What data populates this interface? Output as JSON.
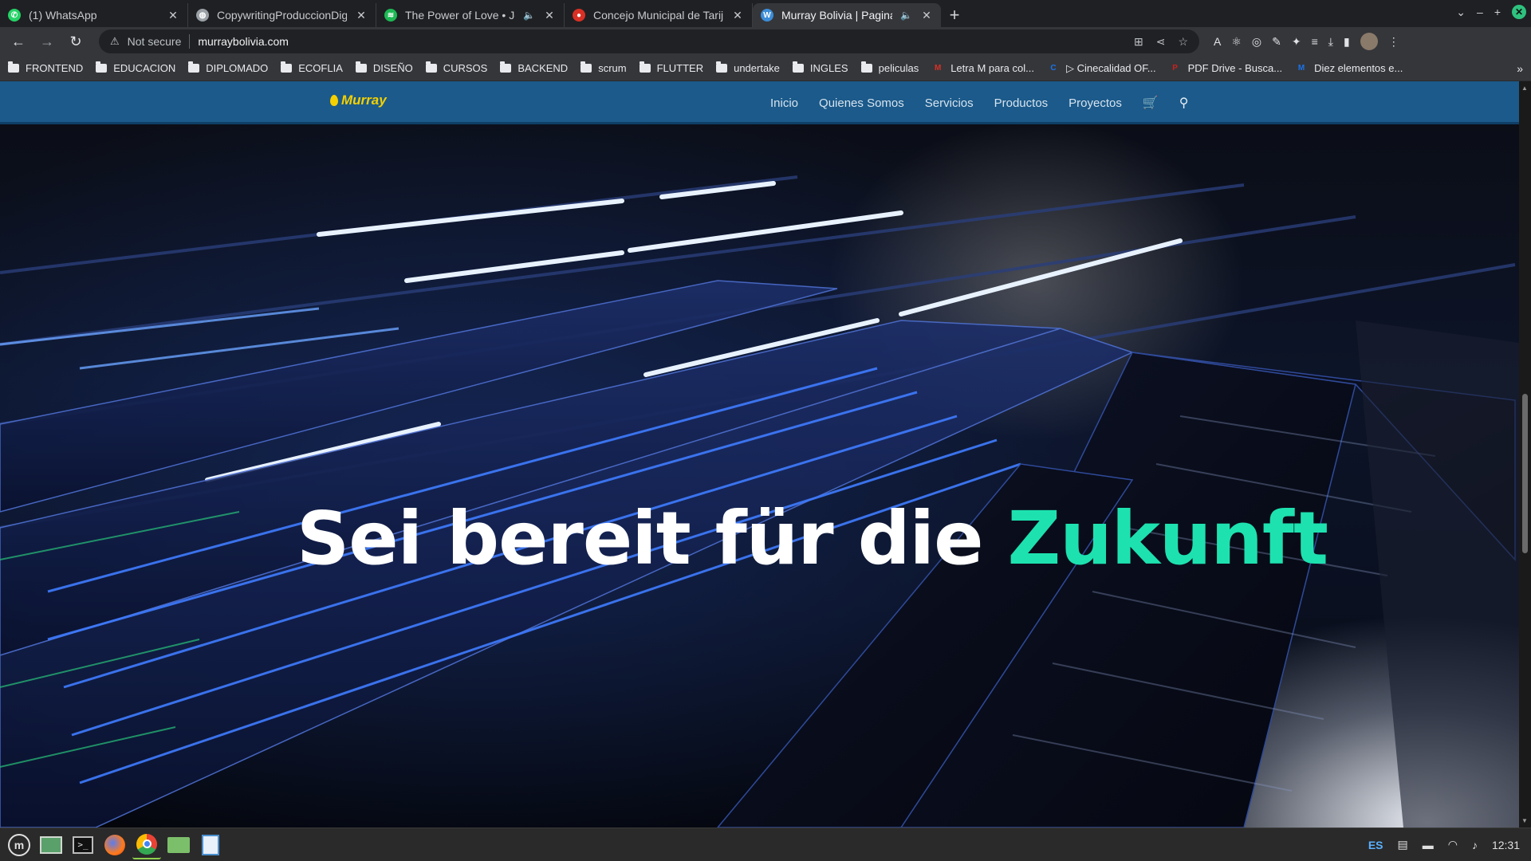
{
  "browser": {
    "tabs": [
      {
        "title": "(1) WhatsApp",
        "icon": "whatsapp-icon",
        "color": "#25d366",
        "audio": false,
        "active": false
      },
      {
        "title": "CopywritingProduccionDigital",
        "icon": "globe-icon",
        "color": "#9aa0a6",
        "audio": false,
        "active": false
      },
      {
        "title": "The Power of Love • Jennifer",
        "icon": "spotify-icon",
        "color": "#1db954",
        "audio": true,
        "active": false
      },
      {
        "title": "Concejo Municipal de Tarija",
        "icon": "municipal-icon",
        "color": "#d93025",
        "audio": false,
        "active": false
      },
      {
        "title": "Murray Bolivia | Pagina Of",
        "icon": "wordpress-icon",
        "color": "#3c8dd8",
        "audio": true,
        "active": true
      }
    ],
    "address": {
      "security": "Not secure",
      "url": "murraybolivia.com"
    },
    "bookmarks": [
      {
        "label": "FRONTEND",
        "type": "folder"
      },
      {
        "label": "EDUCACION",
        "type": "folder"
      },
      {
        "label": "DIPLOMADO",
        "type": "folder"
      },
      {
        "label": "ECOFLIA",
        "type": "folder"
      },
      {
        "label": "DISEÑO",
        "type": "folder"
      },
      {
        "label": "CURSOS",
        "type": "folder"
      },
      {
        "label": "BACKEND",
        "type": "folder"
      },
      {
        "label": "scrum",
        "type": "folder"
      },
      {
        "label": "FLUTTER",
        "type": "folder"
      },
      {
        "label": "undertake",
        "type": "folder"
      },
      {
        "label": "INGLES",
        "type": "folder"
      },
      {
        "label": "peliculas",
        "type": "folder"
      },
      {
        "label": "Letra M para col...",
        "type": "site",
        "color": "#d93025",
        "glyph": "M"
      },
      {
        "label": "▷ Cinecalidad OF...",
        "type": "site",
        "color": "#1a73e8",
        "glyph": "C"
      },
      {
        "label": "PDF Drive - Busca...",
        "type": "site",
        "color": "#c5221f",
        "glyph": "P"
      },
      {
        "label": "Diez elementos e...",
        "type": "site",
        "color": "#1a73e8",
        "glyph": "M"
      }
    ]
  },
  "site": {
    "logo_text": "Murray",
    "menu": [
      "Inicio",
      "Quienes Somos",
      "Servicios",
      "Productos",
      "Proyectos"
    ],
    "headline_main": "Sei bereit für die",
    "headline_accent": "Zukunft"
  },
  "taskbar": {
    "language": "ES",
    "clock": "12:31"
  }
}
